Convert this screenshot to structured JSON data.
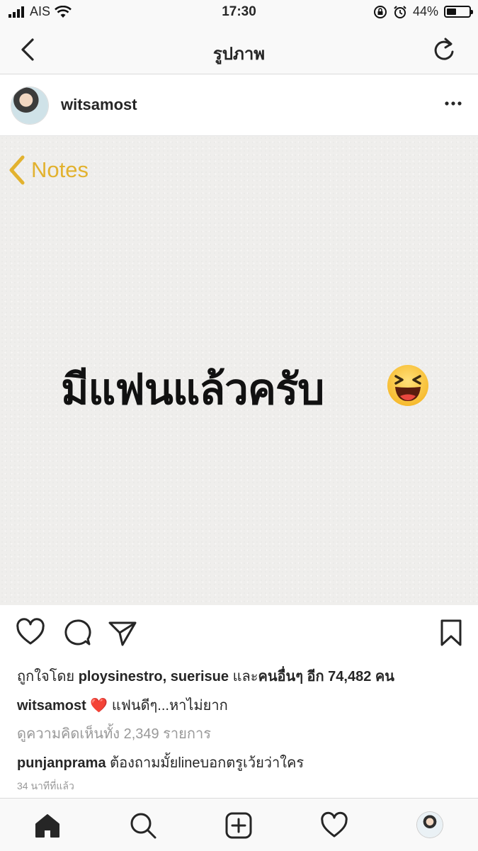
{
  "status_bar": {
    "carrier": "AIS",
    "time": "17:30",
    "battery_percent": "44%",
    "battery_level": 0.44,
    "icons": [
      "signal-bars-icon",
      "wifi-icon",
      "orientation-lock-icon",
      "alarm-icon",
      "battery-icon"
    ]
  },
  "navbar": {
    "title": "รูปภาพ",
    "back_icon": "chevron-left-icon",
    "refresh_icon": "refresh-icon"
  },
  "post": {
    "username": "witsamost",
    "more_icon": "more-dots-icon",
    "image": {
      "notes_back_label": "Notes",
      "main_text": "มีแฟนแล้วครับ",
      "emoji": "laughing-face-emoji",
      "notes_accent": "#e2b22f"
    },
    "actions": [
      "heart-icon",
      "comment-icon",
      "share-icon",
      "bookmark-icon"
    ],
    "likes": {
      "prefix": "ถูกใจโดย",
      "names": "ploysinestro, suerisue",
      "suffix": " และ",
      "others_label": "คนอื่นๆ อีก 74,482 คน"
    },
    "caption": {
      "username": "witsamost",
      "heart": "❤️",
      "text": "แฟนดีๆ...หาไม่ยาก"
    },
    "view_comments_label": "ดูความคิดเห็นทั้ง 2,349 รายการ",
    "comment": {
      "username": "punjanprama",
      "text": "ต้องถามมั้ยlineบอกตรูเว้ยว่าใคร"
    },
    "time_ago": "34 นาทีที่แล้ว"
  },
  "tabbar": {
    "items": [
      "home-icon",
      "search-icon",
      "add-post-icon",
      "activity-heart-icon",
      "profile-avatar"
    ]
  }
}
